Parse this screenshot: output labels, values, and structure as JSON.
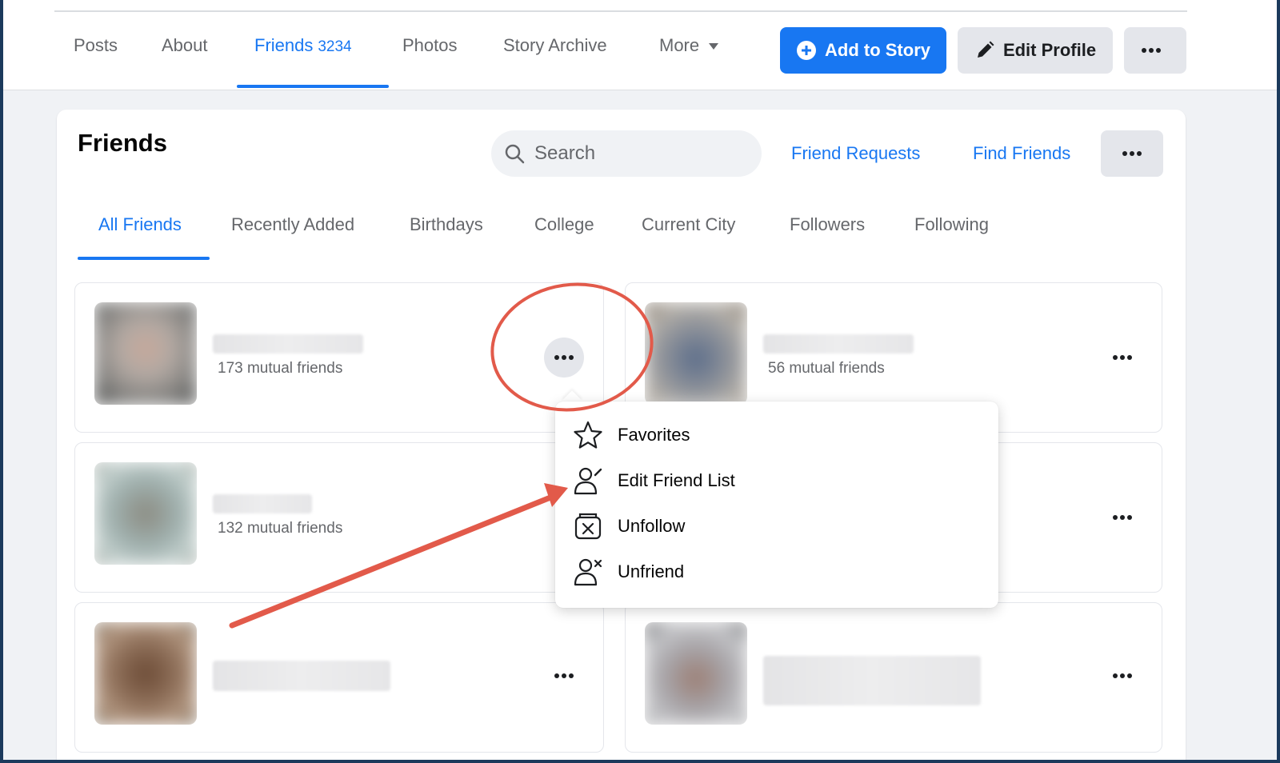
{
  "profile_nav": {
    "tabs": [
      {
        "label": "Posts"
      },
      {
        "label": "About"
      },
      {
        "label": "Friends",
        "count": "3234"
      },
      {
        "label": "Photos"
      },
      {
        "label": "Story Archive"
      },
      {
        "label": "More"
      }
    ],
    "add_to_story": "Add to Story",
    "edit_profile": "Edit Profile"
  },
  "friends_card": {
    "title": "Friends",
    "search_placeholder": "Search",
    "friend_requests": "Friend Requests",
    "find_friends": "Find Friends",
    "subtabs": [
      "All Friends",
      "Recently Added",
      "Birthdays",
      "College",
      "Current City",
      "Followers",
      "Following"
    ]
  },
  "friends": [
    {
      "mutual": "173 mutual friends"
    },
    {
      "mutual": "56 mutual friends"
    },
    {
      "mutual": "132 mutual friends"
    },
    {
      "mutual": ""
    },
    {
      "mutual": ""
    },
    {
      "mutual": ""
    }
  ],
  "context_menu": {
    "items": [
      "Favorites",
      "Edit Friend List",
      "Unfollow",
      "Unfriend"
    ]
  },
  "colors": {
    "accent": "#1877f2",
    "annotation": "#e25a4a",
    "background": "#f0f2f5"
  },
  "icons": [
    "plus-circle-icon",
    "pencil-icon",
    "more-dots-icon",
    "search-icon",
    "star-icon",
    "person-edit-icon",
    "unfollow-icon",
    "person-remove-icon",
    "caret-down-icon"
  ]
}
